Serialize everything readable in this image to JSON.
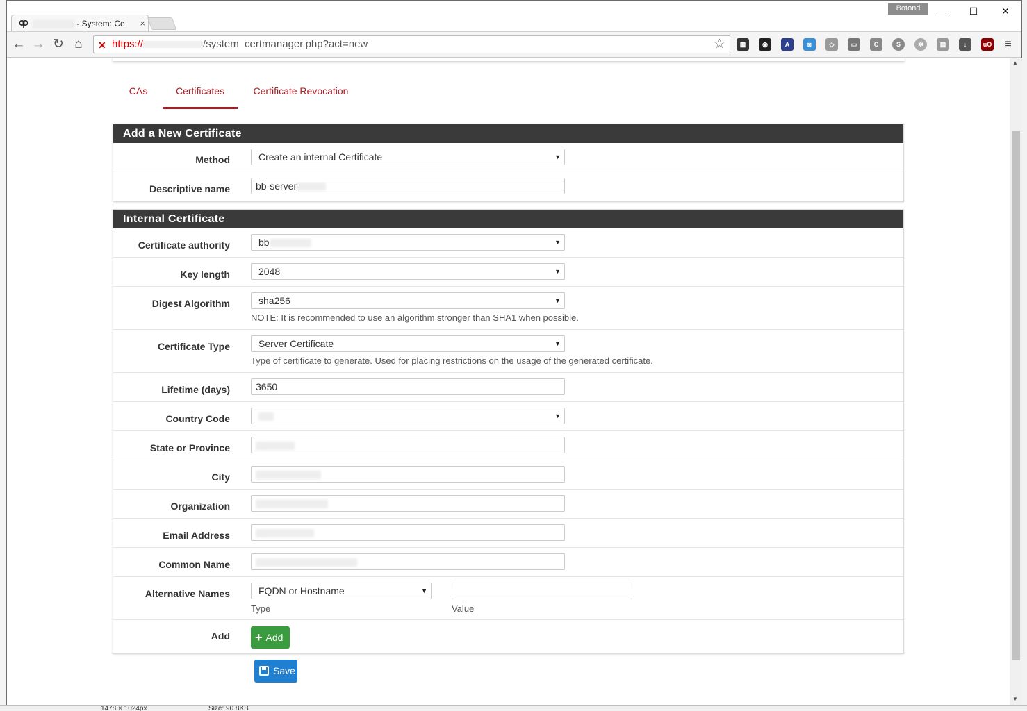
{
  "browser": {
    "tab_title": "- System: Ce",
    "tab_close": "×",
    "profile_name": "Botond",
    "url_scheme": "https://",
    "url_path": "/system_certmanager.php?act=new",
    "minimize": "—",
    "maximize": "☐",
    "close": "✕"
  },
  "tabs": [
    {
      "label": "CAs"
    },
    {
      "label": "Certificates",
      "active": true
    },
    {
      "label": "Certificate Revocation"
    }
  ],
  "panel_new": {
    "title": "Add a New Certificate",
    "method_label": "Method",
    "method_value": "Create an internal Certificate",
    "descr_label": "Descriptive name",
    "descr_value": "bb-server"
  },
  "panel_internal": {
    "title": "Internal Certificate",
    "ca_label": "Certificate authority",
    "ca_value": "bb",
    "keylen_label": "Key length",
    "keylen_value": "2048",
    "digest_label": "Digest Algorithm",
    "digest_value": "sha256",
    "digest_help": "NOTE: It is recommended to use an algorithm stronger than SHA1 when possible.",
    "type_label": "Certificate Type",
    "type_value": "Server Certificate",
    "type_help": "Type of certificate to generate. Used for placing restrictions on the usage of the generated certificate.",
    "lifetime_label": "Lifetime (days)",
    "lifetime_value": "3650",
    "country_label": "Country Code",
    "state_label": "State or Province",
    "city_label": "City",
    "org_label": "Organization",
    "email_label": "Email Address",
    "cn_label": "Common Name",
    "alt_label": "Alternative Names",
    "alt_type_value": "FQDN or Hostname",
    "alt_type_help": "Type",
    "alt_value_help": "Value",
    "add_label": "Add",
    "add_button": "Add"
  },
  "save_button": "Save",
  "status_bar": {
    "dimensions": "1478 × 1024px",
    "size": "Size: 90.8KB"
  },
  "colors": {
    "accent": "#a91e26",
    "panel_header": "#3a3a3a",
    "add_button": "#3a9c3e",
    "save_button": "#1f7fd0"
  }
}
